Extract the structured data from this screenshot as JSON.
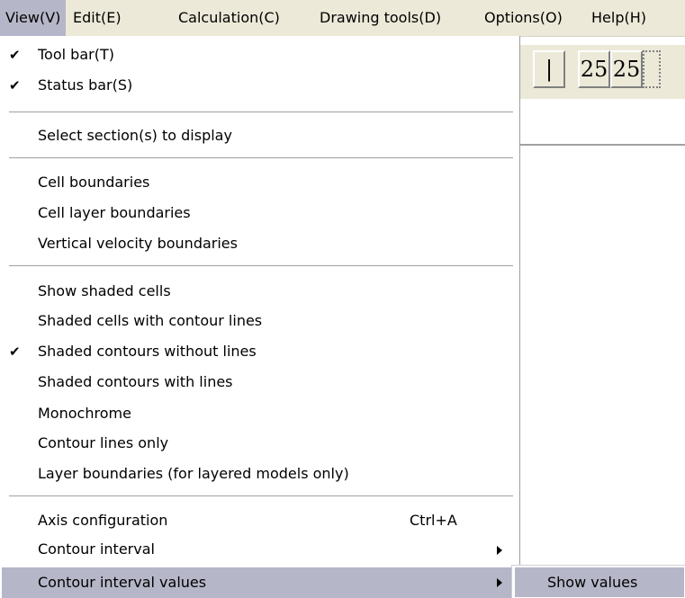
{
  "menubar": {
    "items": [
      {
        "label": "View(V)",
        "active": true
      },
      {
        "label": "Edit(E)"
      },
      {
        "label": "Calculation(C)"
      },
      {
        "label": "Drawing tools(D)"
      },
      {
        "label": "Options(O)"
      },
      {
        "label": "Help(H)"
      }
    ]
  },
  "toolbar": {
    "btn1": "|",
    "btn2": "25",
    "btn3": "25"
  },
  "view_menu": {
    "check_glyph": "✔",
    "items": [
      {
        "label": "Tool bar(T)",
        "checked": true
      },
      {
        "label": "Status bar(S)",
        "checked": true
      },
      {
        "label": "Select section(s) to display"
      },
      {
        "label": "Cell boundaries"
      },
      {
        "label": "Cell layer boundaries"
      },
      {
        "label": "Vertical velocity boundaries"
      },
      {
        "label": "Show shaded cells"
      },
      {
        "label": "Shaded cells with contour lines"
      },
      {
        "label": "Shaded contours without lines",
        "checked": true
      },
      {
        "label": "Shaded contours with lines"
      },
      {
        "label": "Monochrome"
      },
      {
        "label": "Contour lines only"
      },
      {
        "label": "Layer boundaries (for layered models only)"
      },
      {
        "label": "Axis configuration",
        "shortcut": "Ctrl+A"
      },
      {
        "label": "Contour interval",
        "submenu": true
      },
      {
        "label": "Contour interval values",
        "submenu": true,
        "highlighted": true
      }
    ]
  },
  "submenu": {
    "items": [
      {
        "label": "Show values"
      }
    ]
  },
  "colors": {
    "menubar_bg": "#ece9d8",
    "highlight": "#b6b6c9"
  }
}
